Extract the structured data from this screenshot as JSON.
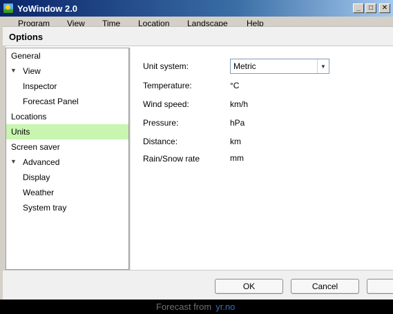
{
  "window": {
    "title": "YoWindow 2.0",
    "minimize_icon": "minimize-icon",
    "maximize_icon": "maximize-icon",
    "close_icon": "close-icon"
  },
  "menu": {
    "items": [
      "Program",
      "View",
      "Time",
      "Location",
      "Landscape",
      "Help"
    ]
  },
  "dialog": {
    "title": "Options"
  },
  "nav": {
    "items": [
      {
        "label": "General"
      },
      {
        "label": "View"
      },
      {
        "label": "Inspector"
      },
      {
        "label": "Forecast Panel"
      },
      {
        "label": "Locations"
      },
      {
        "label": "Units"
      },
      {
        "label": "Screen saver"
      },
      {
        "label": "Advanced"
      },
      {
        "label": "Display"
      },
      {
        "label": "Weather"
      },
      {
        "label": "System tray"
      }
    ],
    "selected": "Units"
  },
  "units": {
    "unit_system_label": "Unit system:",
    "unit_system_value": "Metric",
    "temperature_label": "Temperature:",
    "temperature_value": "°C",
    "wind_label": "Wind speed:",
    "wind_value": "km/h",
    "pressure_label": "Pressure:",
    "pressure_value": "hPa",
    "distance_label": "Distance:",
    "distance_value": "km",
    "rain_label": "Rain/Snow rate",
    "rain_value": "mm"
  },
  "buttons": {
    "ok": "OK",
    "cancel": "Cancel"
  },
  "bottom": {
    "text": "Forecast from",
    "link": "yr.no"
  },
  "colors": {
    "selected_nav": "#c8f5b0",
    "titlebar": "#0a246a",
    "link": "#3c6fb4"
  }
}
